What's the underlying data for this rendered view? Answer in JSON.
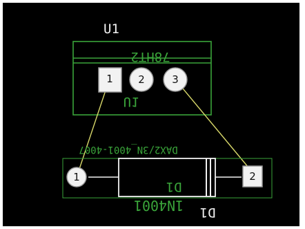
{
  "components": {
    "u1": {
      "refdes": "U1",
      "value": "78HT2",
      "body_label": "U1",
      "pads": [
        "1",
        "2",
        "3"
      ]
    },
    "d1": {
      "refdes": "D1",
      "value": "1N4001",
      "body_label": "D1",
      "footprint_text": "DAX2/3N_4001-4007",
      "pads": [
        "1",
        "2"
      ]
    }
  },
  "colors": {
    "background": "#000000",
    "silkscreen_white": "#f2f2f2",
    "silkscreen_green": "#3aa43a",
    "ratsnest": "#d8d86a",
    "pad_fill": "#f2f2f2"
  }
}
